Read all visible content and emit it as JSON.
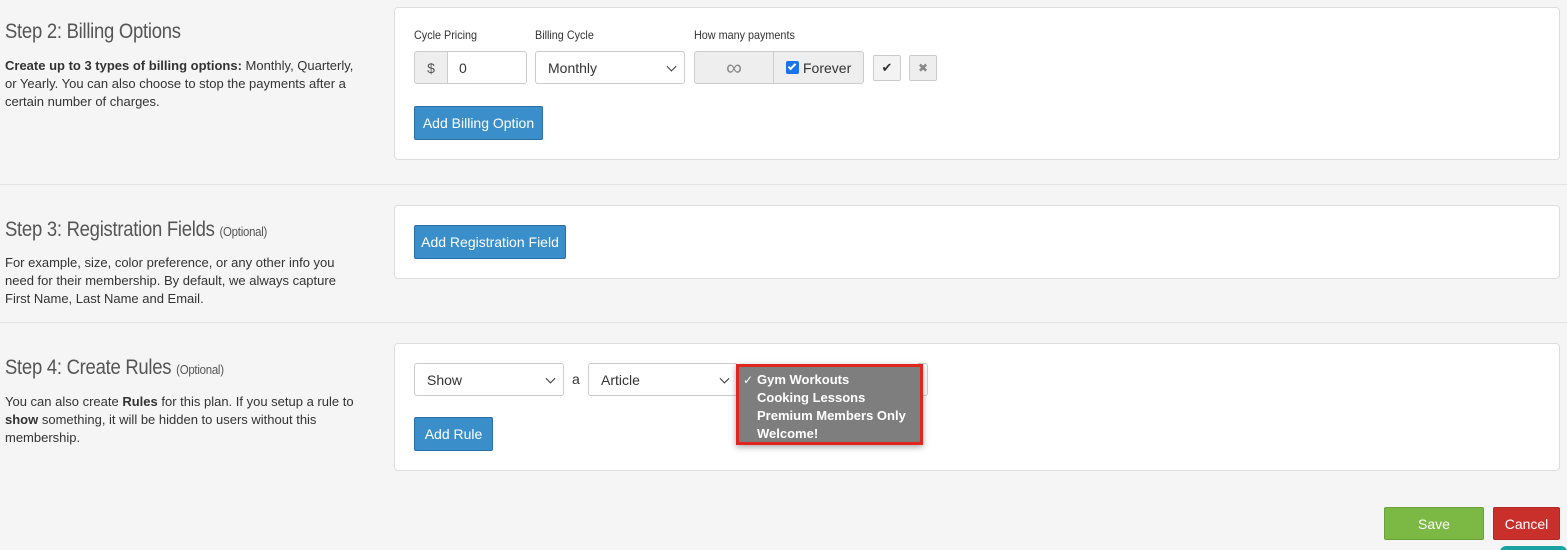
{
  "step2": {
    "title": "Step 2: Billing Options",
    "desc_bold": "Create up to 3 types of billing options:",
    "desc_rest": " Monthly, Quarterly, or Yearly. You can also choose to stop the payments after a certain number of charges.",
    "cycle_pricing_label": "Cycle Pricing",
    "currency_symbol": "$",
    "price_value": "0",
    "billing_cycle_label": "Billing Cycle",
    "billing_cycle_value": "Monthly",
    "payments_label": "How many payments",
    "infinity_symbol": "∞",
    "forever_label": "Forever",
    "forever_checked": true,
    "confirm_symbol": "✔",
    "remove_symbol": "✖",
    "add_button": "Add Billing Option"
  },
  "step3": {
    "title": "Step 3: Registration Fields",
    "optional": "(Optional)",
    "desc": "For example, size, color preference, or any other info you need for their membership. By default, we always capture First Name, Last Name and Email.",
    "add_button": "Add Registration Field"
  },
  "step4": {
    "title": "Step 4: Create Rules",
    "optional": "(Optional)",
    "desc_1": "You can also create ",
    "desc_bold_1": "Rules",
    "desc_2": " for this plan. If you setup a rule to ",
    "desc_bold_2": "show",
    "desc_3": " something, it will be hidden to users without this membership.",
    "action_select": "Show",
    "connector": "a",
    "type_select": "Article",
    "dropdown_items": [
      {
        "label": "Gym Workouts",
        "selected": true
      },
      {
        "label": "Cooking Lessons",
        "selected": false
      },
      {
        "label": "Premium Members Only",
        "selected": false
      },
      {
        "label": "Welcome!",
        "selected": false
      }
    ],
    "check_symbol": "✓",
    "add_button": "Add Rule"
  },
  "footer": {
    "save": "Save",
    "cancel": "Cancel"
  },
  "colors": {
    "primary": "#3a8fcb",
    "save": "#7cb844",
    "cancel": "#c9302c",
    "highlight": "#e0271f"
  }
}
